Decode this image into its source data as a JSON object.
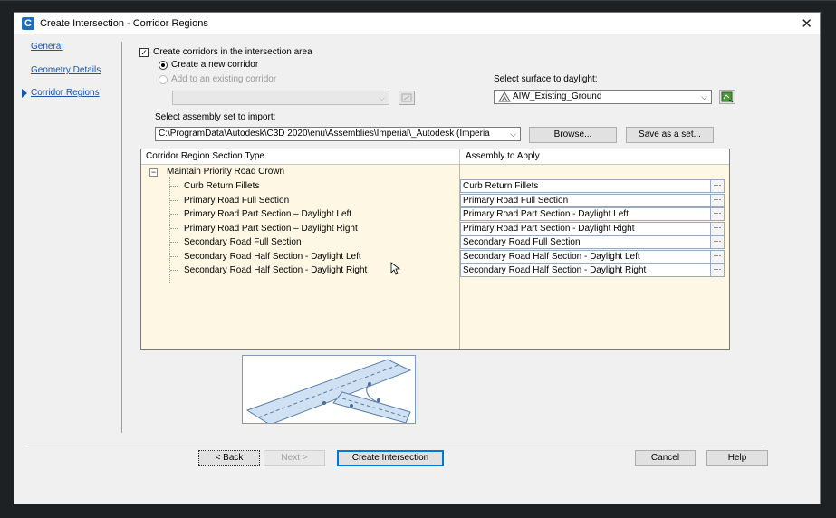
{
  "window": {
    "title": "Create Intersection - Corridor Regions",
    "close_glyph": "✕",
    "app_icon_letter": "C"
  },
  "nav": {
    "items": [
      {
        "label": "General"
      },
      {
        "label": "Geometry Details"
      },
      {
        "label": "Corridor Regions",
        "active": true
      }
    ]
  },
  "options": {
    "create_corridors_label": "Create corridors in the intersection area",
    "create_corridors_checked": true,
    "create_new_label": "Create a new corridor",
    "add_existing_label": "Add to an existing corridor",
    "existing_corridor_value": ""
  },
  "surface": {
    "label": "Select surface to daylight:",
    "value": "AIW_Existing_Ground"
  },
  "assembly_set": {
    "label": "Select assembly set to import:",
    "value": "C:\\ProgramData\\Autodesk\\C3D 2020\\enu\\Assemblies\\Imperial\\_Autodesk (Imperia",
    "browse_label": "Browse...",
    "save_as_set_label": "Save as a set..."
  },
  "grid": {
    "col1_header": "Corridor Region Section Type",
    "col2_header": "Assembly to Apply",
    "group_label": "Maintain Priority Road Crown",
    "group_toggle": "−",
    "ellipsis": "···",
    "rows": [
      {
        "section": "Curb Return Fillets",
        "assembly": "Curb Return Fillets"
      },
      {
        "section": "Primary Road Full Section",
        "assembly": "Primary Road Full Section"
      },
      {
        "section": "Primary Road Part Section – Daylight Left",
        "assembly": "Primary Road Part Section - Daylight Left"
      },
      {
        "section": "Primary Road Part Section – Daylight Right",
        "assembly": "Primary Road Part Section - Daylight Right"
      },
      {
        "section": "Secondary Road Full Section",
        "assembly": "Secondary Road Full Section"
      },
      {
        "section": "Secondary Road Half Section - Daylight Left",
        "assembly": "Secondary Road Half Section - Daylight Left"
      },
      {
        "section": "Secondary Road Half Section - Daylight Right",
        "assembly": "Secondary Road Half Section - Daylight Right"
      }
    ]
  },
  "footer": {
    "back_label": "< Back",
    "next_label": "Next >",
    "create_label": "Create Intersection",
    "cancel_label": "Cancel",
    "help_label": "Help"
  },
  "colors": {
    "link": "#1a55a8",
    "grid_background": "#fdf7e3",
    "default_button_border": "#0078d7"
  },
  "icons": {
    "surface_icon": "surface-triangle-icon",
    "surface_pick_icon": "pick-surface-icon",
    "corridor_pick_icon": "pick-corridor-icon"
  }
}
